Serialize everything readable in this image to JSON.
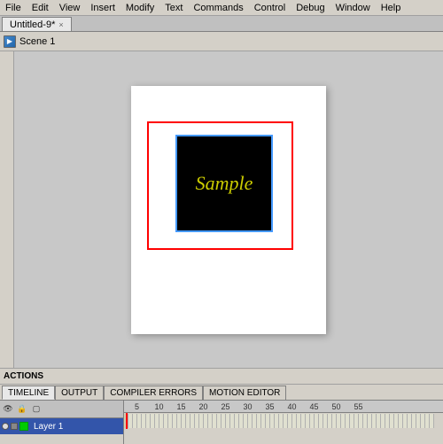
{
  "menubar": {
    "items": [
      "File",
      "Edit",
      "View",
      "Insert",
      "Modify",
      "Text",
      "Commands",
      "Control",
      "Debug",
      "Window",
      "Help"
    ]
  },
  "tab": {
    "label": "Untitled-9*",
    "close": "×"
  },
  "scene": {
    "label": "Scene 1"
  },
  "canvas": {
    "sample_text": "Sample"
  },
  "bottom": {
    "actions_label": "ACTIONS"
  },
  "timeline": {
    "tabs": [
      "TIMELINE",
      "OUTPUT",
      "COMPILER ERRORS",
      "MOTION EDITOR"
    ],
    "active_tab": "TIMELINE",
    "layer_name": "Layer 1",
    "frame_numbers": [
      "5",
      "10",
      "15",
      "20",
      "25",
      "30",
      "35",
      "40",
      "45",
      "50",
      "55"
    ]
  }
}
